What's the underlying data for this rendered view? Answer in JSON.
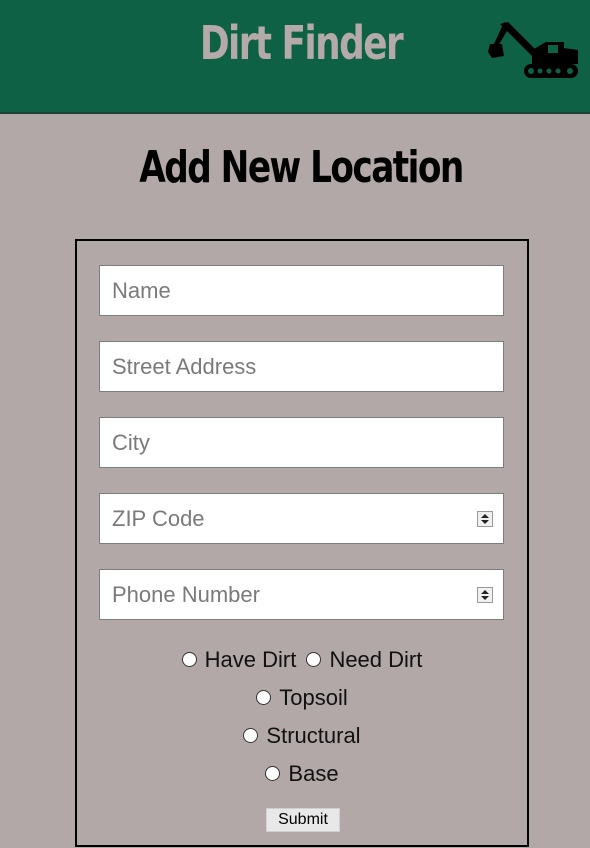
{
  "header": {
    "app_title": "Dirt Finder",
    "logo_icon": "excavator-icon",
    "background": "#0f6146",
    "title_color": "#b3aaa9"
  },
  "page": {
    "title": "Add New Location",
    "background": "#b1a8a7"
  },
  "form": {
    "fields": {
      "name": {
        "placeholder": "Name",
        "value": ""
      },
      "street": {
        "placeholder": "Street Address",
        "value": ""
      },
      "city": {
        "placeholder": "City",
        "value": ""
      },
      "zip": {
        "placeholder": "ZIP Code",
        "value": ""
      },
      "phone": {
        "placeholder": "Phone Number",
        "value": ""
      }
    },
    "radios": {
      "have_dirt": "Have Dirt",
      "need_dirt": "Need Dirt",
      "topsoil": "Topsoil",
      "structural": "Structural",
      "base": "Base"
    },
    "submit_label": "Submit"
  }
}
